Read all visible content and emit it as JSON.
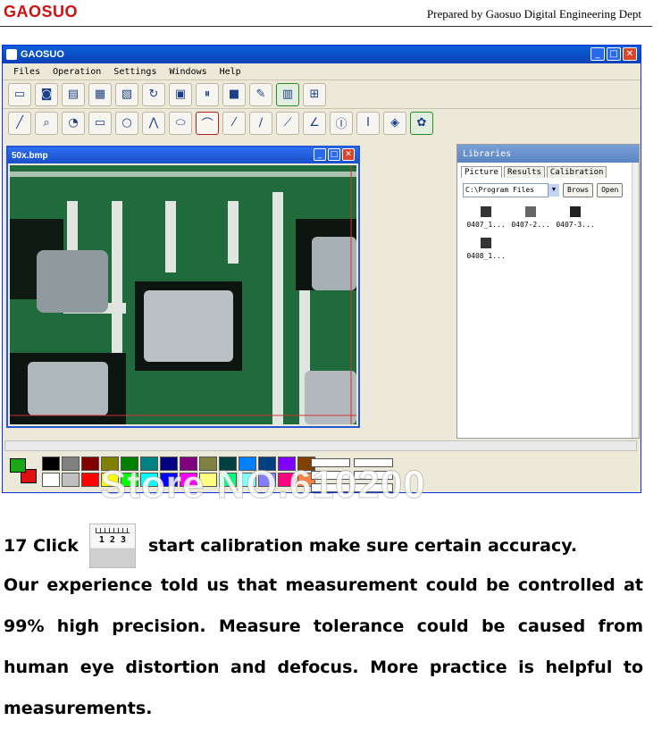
{
  "header": {
    "brand": "GAOSUO",
    "prepared_by": "Prepared by Gaosuo Digital Engineering Dept"
  },
  "app": {
    "title": "GAOSUO",
    "menu": [
      "Files",
      "Operation",
      "Settings",
      "Windows",
      "Help"
    ],
    "image_window": {
      "title": "50x.bmp"
    },
    "libraries": {
      "title": "Libraries",
      "tabs": [
        "Picture",
        "Results",
        "Calibration"
      ],
      "path": "C:\\Program Files",
      "browse_label": "Brows",
      "open_label": "Open",
      "thumbnails": [
        "0407_1...",
        "0407-2...",
        "0407-3...",
        "0408_1..."
      ]
    },
    "toolbar_icons": [
      "monitor-icon",
      "camera-icon",
      "folder-icon",
      "document-icon",
      "export-icon",
      "refresh-icon",
      "save-icon",
      "pause-icon",
      "stop-icon",
      "wrench-icon",
      "grid-icon",
      "calibration-icon"
    ],
    "draw_icons": [
      "line-icon",
      "zoom-icon",
      "circle-zoom-icon",
      "rectangle-icon",
      "circle-icon",
      "polyline-icon",
      "ellipse-icon",
      "arc-icon",
      "point-line-icon",
      "angle-line-icon",
      "angle2-icon",
      "protractor-icon",
      "vertical-measure-icon",
      "horizontal-measure-icon",
      "diamond-icon",
      "palette-icon"
    ],
    "palette_colors": [
      "#000000",
      "#808080",
      "#800000",
      "#808000",
      "#008000",
      "#008080",
      "#000080",
      "#800080",
      "#808040",
      "#004040",
      "#0080ff",
      "#004080",
      "#8000ff",
      "#804000",
      "#ffffff",
      "#c0c0c0",
      "#ff0000",
      "#ffff00",
      "#00ff00",
      "#00ffff",
      "#0000ff",
      "#ff00ff",
      "#ffff80",
      "#00ff80",
      "#80ffff",
      "#8080ff",
      "#ff0080",
      "#ff8040"
    ]
  },
  "watermark": "Store NO.610200",
  "step": {
    "prefix": "17 Click",
    "icon_numbers": "1 2 3",
    "suffix": "start calibration make sure certain accuracy."
  },
  "paragraph": "Our experience told us that measurement could be controlled at 99% high precision. Measure tolerance could be caused from human eye distortion and defocus. More practice is helpful to measurements."
}
